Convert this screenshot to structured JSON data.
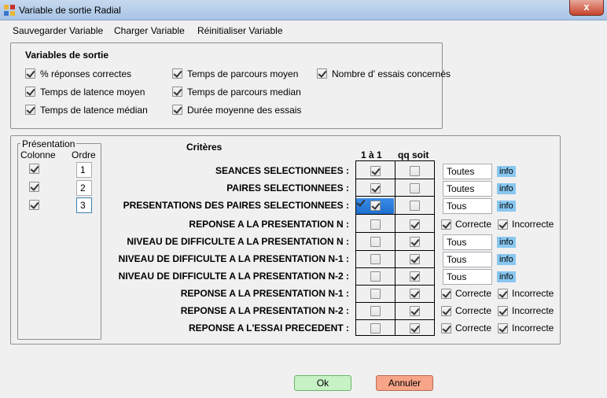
{
  "window": {
    "title": "Variable de sortie Radial",
    "close_label": "x"
  },
  "menu": {
    "items": [
      "Sauvegarder Variable",
      "Charger Variable",
      "Réinitialiser Variable"
    ]
  },
  "output_vars": {
    "legend": "Variables de sortie",
    "items": [
      {
        "label": "% réponses correctes",
        "checked": true
      },
      {
        "label": "Temps de latence moyen",
        "checked": true
      },
      {
        "label": "Temps de latence médian",
        "checked": true
      },
      {
        "label": "Temps de parcours moyen",
        "checked": true
      },
      {
        "label": "Temps de parcours median",
        "checked": true
      },
      {
        "label": "Durée moyenne des essais",
        "checked": true
      },
      {
        "label": "Nombre d' essais concernés",
        "checked": true
      }
    ]
  },
  "presentation": {
    "legend": "Présentation",
    "col_header": "Colonne",
    "order_header": "Ordre",
    "rows": [
      {
        "checked": true,
        "order": "1"
      },
      {
        "checked": true,
        "order": "2"
      },
      {
        "checked": true,
        "order": "3"
      }
    ]
  },
  "criteria": {
    "title": "Critères",
    "col1": "1 à 1",
    "col2": "qq soit",
    "info_label": "info",
    "correct_label": "Correcte",
    "incorrect_label": "Incorrecte",
    "rows": [
      {
        "label": "SEANCES SELECTIONNEES :",
        "one": true,
        "any": false,
        "kind": "text",
        "value": "Toutes"
      },
      {
        "label": "PAIRES SELECTIONNEES :",
        "one": true,
        "any": false,
        "kind": "text",
        "value": "Toutes"
      },
      {
        "label": "PRESENTATIONS DES PAIRES SELECTIONNEES :",
        "one": true,
        "any": false,
        "kind": "text",
        "value": "Tous",
        "highlight": true
      },
      {
        "label": "REPONSE A LA PRESENTATION N :",
        "one": false,
        "any": true,
        "kind": "check"
      },
      {
        "label": "NIVEAU DE DIFFICULTE A LA PRESENTATION N :",
        "one": false,
        "any": true,
        "kind": "text",
        "value": "Tous"
      },
      {
        "label": "NIVEAU DE DIFFICULTE A LA PRESENTATION N-1 :",
        "one": false,
        "any": true,
        "kind": "text",
        "value": "Tous"
      },
      {
        "label": "NIVEAU DE DIFFICULTE A LA PRESENTATION N-2 :",
        "one": false,
        "any": true,
        "kind": "text",
        "value": "Tous"
      },
      {
        "label": "REPONSE A LA PRESENTATION N-1 :",
        "one": false,
        "any": true,
        "kind": "check"
      },
      {
        "label": "REPONSE A LA PRESENTATION N-2 :",
        "one": false,
        "any": true,
        "kind": "check"
      },
      {
        "label": "REPONSE A L'ESSAI PRECEDENT :",
        "one": false,
        "any": true,
        "kind": "check"
      }
    ]
  },
  "buttons": {
    "ok": "Ok",
    "cancel": "Annuler"
  },
  "colors": {
    "ok_bg": "#c6f2c6",
    "cancel_bg": "#f7a488",
    "info_bg": "#89c7f0"
  }
}
